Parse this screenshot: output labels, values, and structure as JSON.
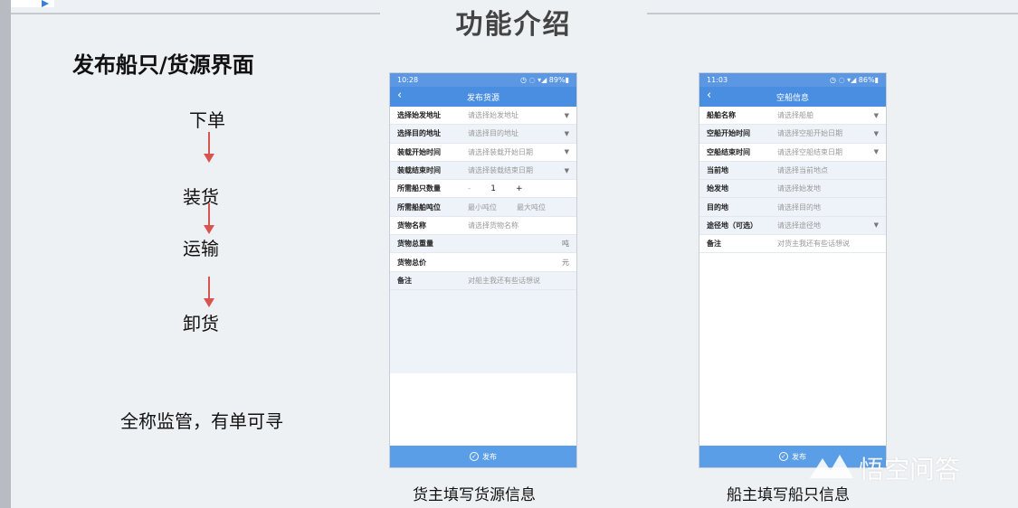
{
  "page_title": "功能介绍",
  "section_title": "发布船只/货源界面",
  "flow": [
    "下单",
    "装货",
    "运输",
    "卸货"
  ],
  "summary": "全称监管，有单可寻",
  "phone1": {
    "time": "10:28",
    "status": "◷ ◌ ▾◢ 89%▮",
    "title": "发布货源",
    "rows": [
      {
        "label": "选择始发地址",
        "value": "请选择始发地址"
      },
      {
        "label": "选择目的地址",
        "value": "请选择目的地址"
      },
      {
        "label": "装载开始时间",
        "value": "请选择装载开始日期"
      },
      {
        "label": "装载结束时间",
        "value": "请选择装载结束日期"
      },
      {
        "label": "所需船只数量",
        "minus": "-",
        "qty": "1",
        "plus": "+"
      },
      {
        "label": "所需船舶吨位",
        "min": "最小吨位",
        "max": "最大吨位"
      },
      {
        "label": "货物名称",
        "value": "请选择货物名称"
      },
      {
        "label": "货物总重量",
        "unit": "吨"
      },
      {
        "label": "货物总价",
        "unit": "元"
      },
      {
        "label": "备注",
        "value": "对船主我还有些话想说"
      }
    ],
    "submit": "发布",
    "caption": "货主填写货源信息"
  },
  "phone2": {
    "time": "11:03",
    "status": "◷ ◌ ▾◢ 86%▮",
    "title": "空船信息",
    "rows": [
      {
        "label": "船舶名称",
        "value": "请选择船舶"
      },
      {
        "label": "空船开始时间",
        "value": "请选择空船开始日期"
      },
      {
        "label": "空船结束时间",
        "value": "请选择空船结束日期"
      },
      {
        "label": "当前地",
        "value": "请选择当前地点"
      },
      {
        "label": "始发地",
        "value": "请选择始发地"
      },
      {
        "label": "目的地",
        "value": "请选择目的地"
      },
      {
        "label": "途径地（可选）",
        "value": "请选择途径地"
      },
      {
        "label": "备注",
        "value": "对货主我还有些话想说"
      }
    ],
    "submit": "发布",
    "caption": "船主填写船只信息"
  },
  "watermark": "悟空问答",
  "colors": {
    "header_blue": "#4a8ee2",
    "button_blue": "#5b9ee8",
    "arrow_red": "#d9534f"
  }
}
